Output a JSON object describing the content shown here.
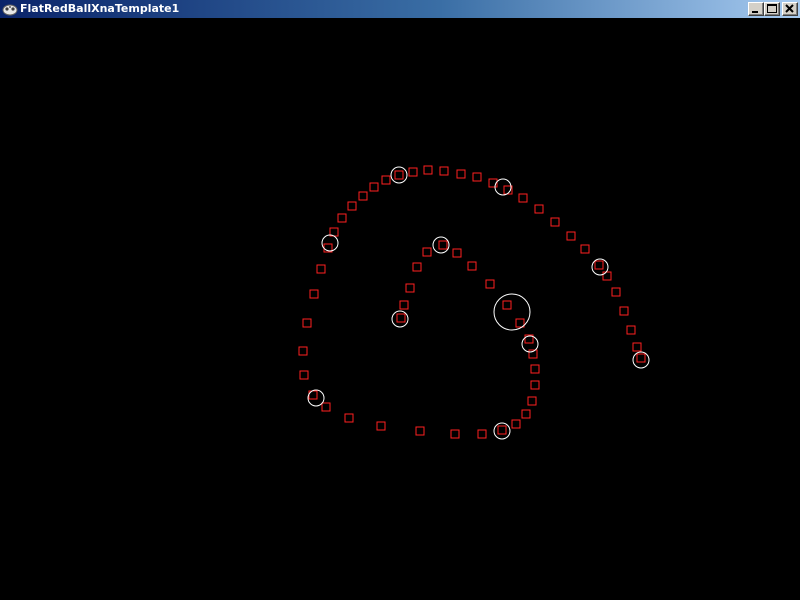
{
  "window": {
    "title": "FlatRedBallXnaTemplate1",
    "app_icon": "xna-gamepad-icon",
    "caption_buttons": [
      {
        "name": "minimize",
        "icon": "minimize-icon"
      },
      {
        "name": "maximize",
        "icon": "maximize-icon"
      },
      {
        "name": "close",
        "icon": "close-icon"
      }
    ]
  },
  "scene": {
    "background_color": "#000000",
    "square_color": "#ff2020",
    "circle_color": "#ffffff"
  }
}
